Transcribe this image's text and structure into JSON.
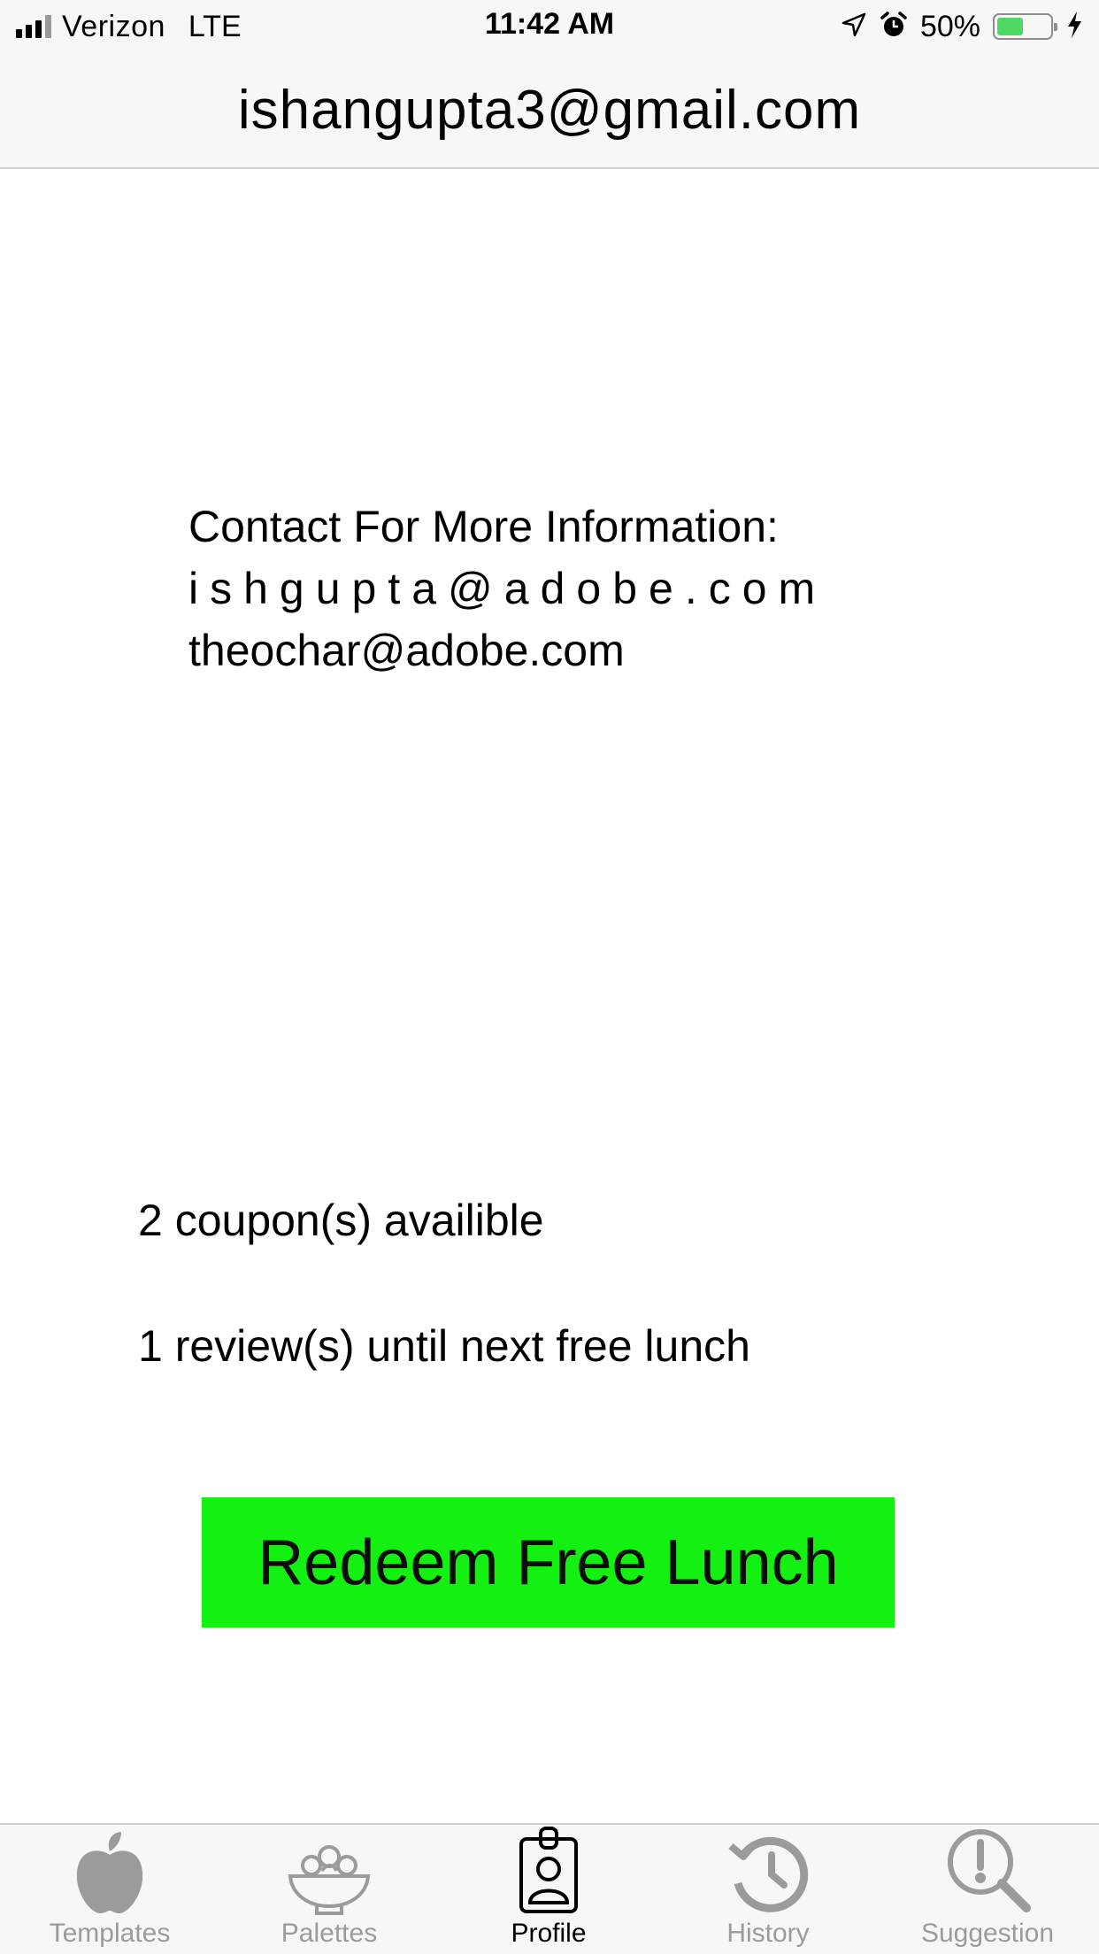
{
  "status_bar": {
    "carrier": "Verizon",
    "network": "LTE",
    "time": "11:42 AM",
    "battery_percent_text": "50%",
    "battery_level": 0.5,
    "battery_color": "#4cd964"
  },
  "header": {
    "title": "ishangupta3@gmail.com"
  },
  "contact": {
    "heading": "Contact For More Information:",
    "emails": [
      "ishgupta@adobe.com",
      "theochar@adobe.com"
    ]
  },
  "stats": {
    "coupons": "2 coupon(s) availible",
    "reviews": "1 review(s) until next free lunch"
  },
  "redeem": {
    "label": "Redeem Free Lunch",
    "color": "#13f011"
  },
  "tab_bar": {
    "active": "Profile",
    "tabs": [
      {
        "label": "Templates",
        "icon": "apple-icon"
      },
      {
        "label": "Palettes",
        "icon": "salad-bowl-icon"
      },
      {
        "label": "Profile",
        "icon": "id-badge-icon"
      },
      {
        "label": "History",
        "icon": "history-icon"
      },
      {
        "label": "Suggestion",
        "icon": "suggestion-icon"
      }
    ]
  }
}
